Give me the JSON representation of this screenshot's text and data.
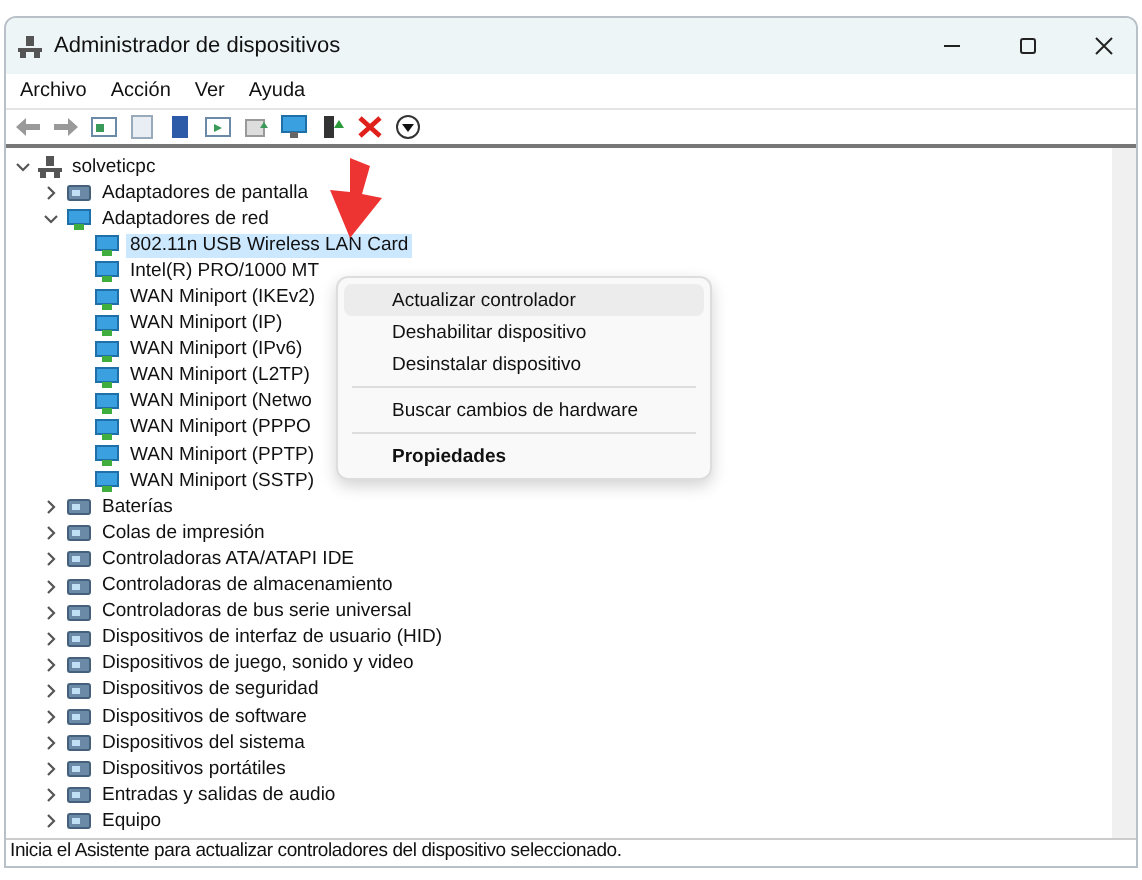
{
  "window": {
    "title": "Administrador de dispositivos"
  },
  "menu": [
    "Archivo",
    "Acción",
    "Ver",
    "Ayuda"
  ],
  "tree": {
    "label": "solveticpc",
    "expanded": true,
    "selected": false,
    "children": [
      {
        "label": "Adaptadores de pantalla",
        "expanded": false,
        "selected": false
      },
      {
        "label": "Adaptadores de red",
        "expanded": true,
        "selected": false,
        "children": [
          {
            "label": "802.11n USB Wireless LAN Card",
            "selected": true
          },
          {
            "label": "Intel(R) PRO/1000 MT",
            "selected": false
          },
          {
            "label": "WAN Miniport (IKEv2)",
            "selected": false
          },
          {
            "label": "WAN Miniport (IP)",
            "selected": false
          },
          {
            "label": "WAN Miniport (IPv6)",
            "selected": false
          },
          {
            "label": "WAN Miniport (L2TP)",
            "selected": false
          },
          {
            "label": "WAN Miniport (Netwo",
            "selected": false
          },
          {
            "label": "WAN Miniport (PPPO",
            "selected": false
          },
          {
            "label": "WAN Miniport (PPTP)",
            "selected": false
          },
          {
            "label": "WAN Miniport (SSTP)",
            "selected": false
          }
        ]
      },
      {
        "label": "Baterías",
        "expanded": false,
        "selected": false
      },
      {
        "label": "Colas de impresión",
        "expanded": false,
        "selected": false
      },
      {
        "label": "Controladoras ATA/ATAPI IDE",
        "expanded": false,
        "selected": false
      },
      {
        "label": "Controladoras de almacenamiento",
        "expanded": false,
        "selected": false
      },
      {
        "label": "Controladoras de bus serie universal",
        "expanded": false,
        "selected": false
      },
      {
        "label": "Dispositivos de interfaz de usuario (HID)",
        "expanded": false,
        "selected": false
      },
      {
        "label": "Dispositivos de juego, sonido y video",
        "expanded": false,
        "selected": false
      },
      {
        "label": "Dispositivos de seguridad",
        "expanded": false,
        "selected": false
      },
      {
        "label": "Dispositivos de software",
        "expanded": false,
        "selected": false
      },
      {
        "label": "Dispositivos del sistema",
        "expanded": false,
        "selected": false
      },
      {
        "label": "Dispositivos portátiles",
        "expanded": false,
        "selected": false
      },
      {
        "label": "Entradas y salidas de audio",
        "expanded": false,
        "selected": false
      },
      {
        "label": "Equipo",
        "expanded": false,
        "selected": false
      }
    ]
  },
  "context_menu": [
    {
      "kind": "item",
      "label": "Actualizar controlador",
      "highlighted": true,
      "default": false
    },
    {
      "kind": "item",
      "label": "Deshabilitar dispositivo",
      "highlighted": false,
      "default": false
    },
    {
      "kind": "item",
      "label": "Desinstalar dispositivo",
      "highlighted": false,
      "default": false
    },
    {
      "kind": "separator"
    },
    {
      "kind": "item",
      "label": "Buscar cambios de hardware",
      "highlighted": false,
      "default": false
    },
    {
      "kind": "separator"
    },
    {
      "kind": "item",
      "label": "Propiedades",
      "highlighted": false,
      "default": true
    }
  ],
  "status_bar": "Inicia el Asistente para actualizar controladores del dispositivo seleccionado."
}
